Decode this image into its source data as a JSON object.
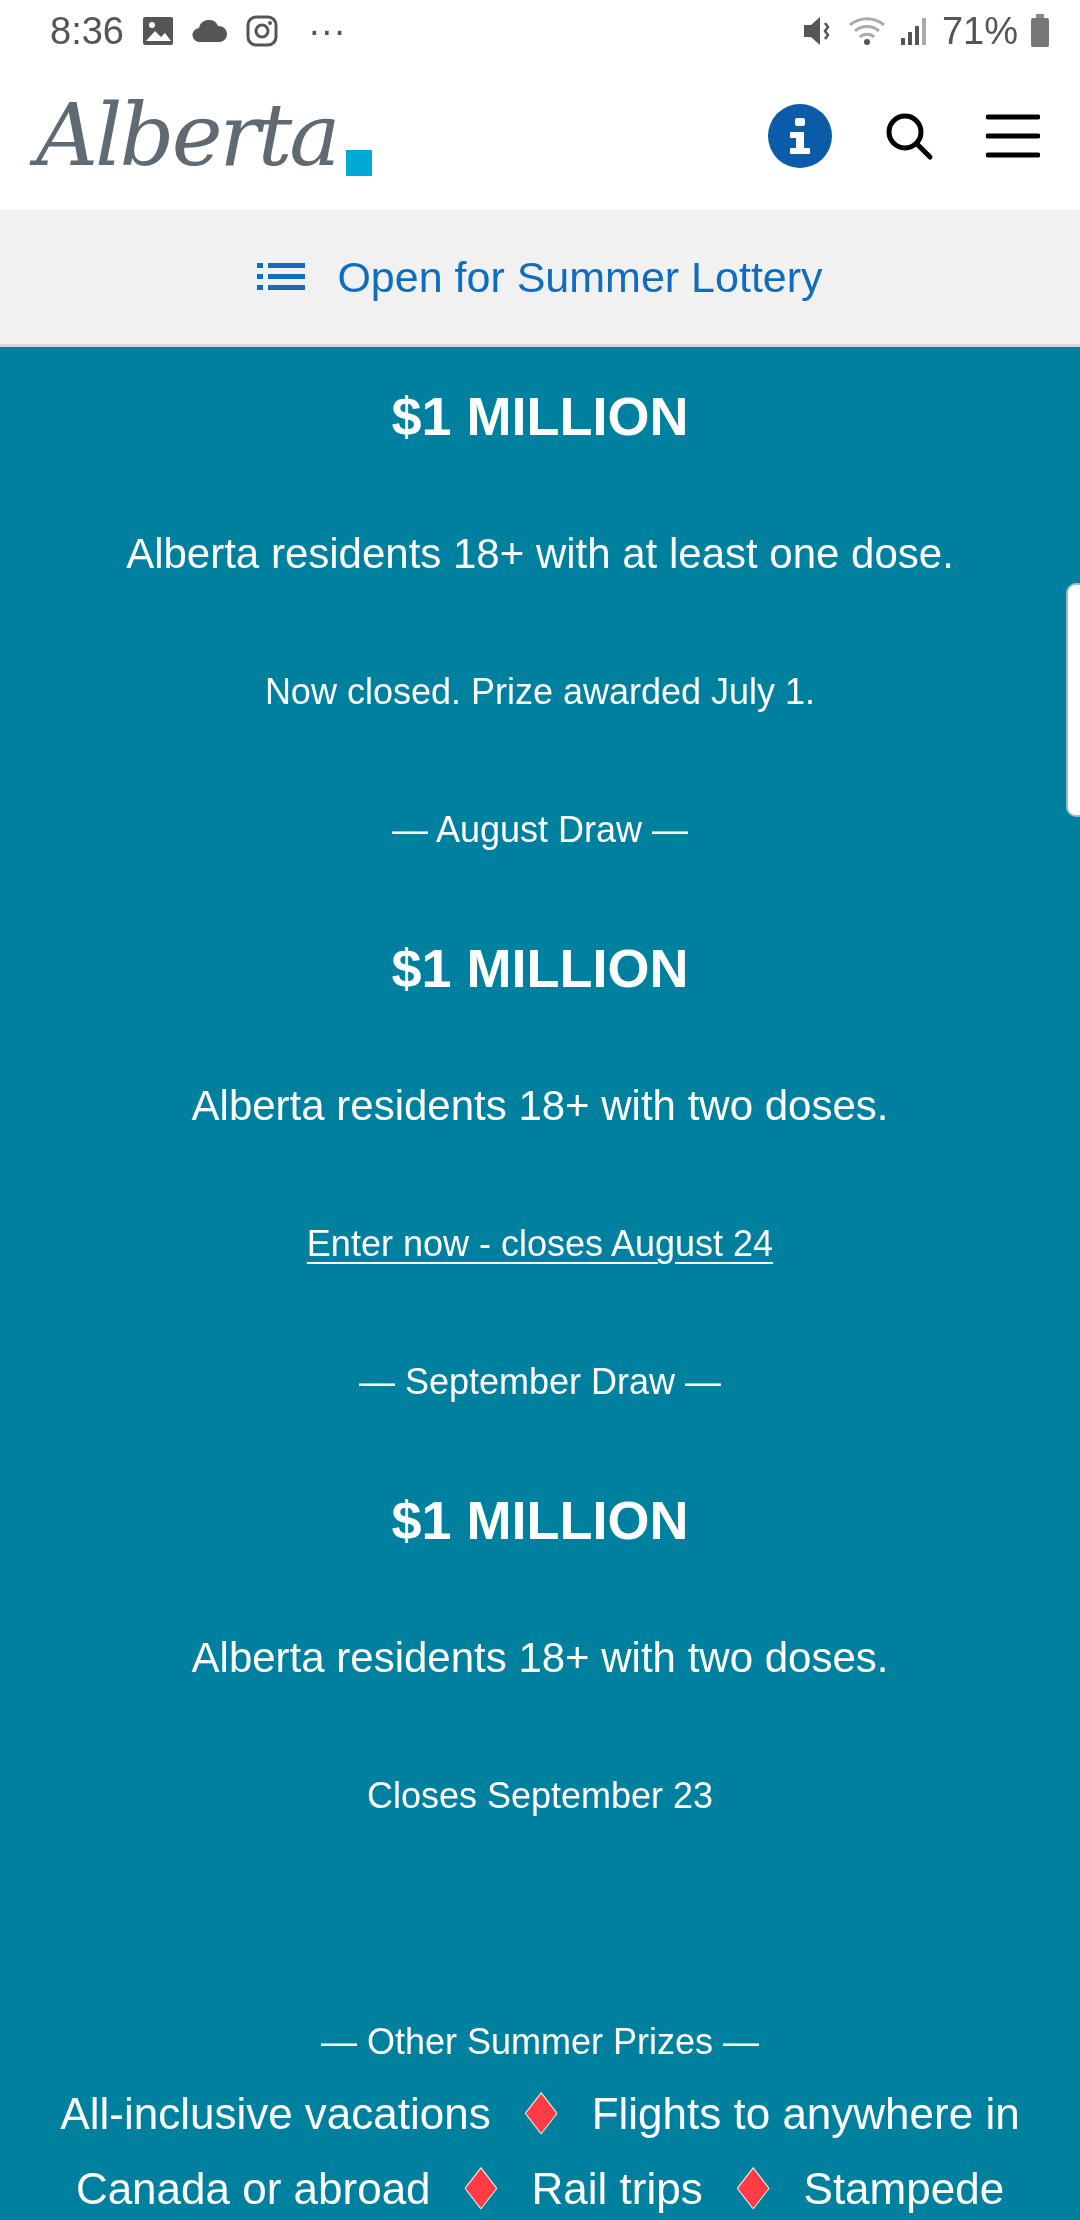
{
  "status_bar": {
    "time": "8:36",
    "more": "···",
    "battery_text": "71%"
  },
  "header": {
    "logo": "Alberta"
  },
  "toc_bar": {
    "label": "Open for Summer Lottery"
  },
  "draws": [
    {
      "prize": "$1 MILLION",
      "eligibility": "Alberta residents 18+ with at least one dose.",
      "status": "Now closed. Prize awarded July 1.",
      "kind": "text"
    },
    {
      "heading": "— August Draw —",
      "prize": "$1 MILLION",
      "eligibility": "Alberta residents 18+ with two doses.",
      "status": "Enter now - closes August 24",
      "kind": "link"
    },
    {
      "heading": "— September Draw —",
      "prize": "$1 MILLION",
      "eligibility": "Alberta residents 18+ with two doses.",
      "status": "Closes September 23",
      "kind": "text"
    }
  ],
  "other_prizes": {
    "heading": "— Other Summer Prizes —",
    "separator": "♦",
    "items": [
      "All-inclusive vacations",
      "Flights to anywhere in Canada or abroad",
      "Rail trips",
      "Stampede"
    ]
  }
}
